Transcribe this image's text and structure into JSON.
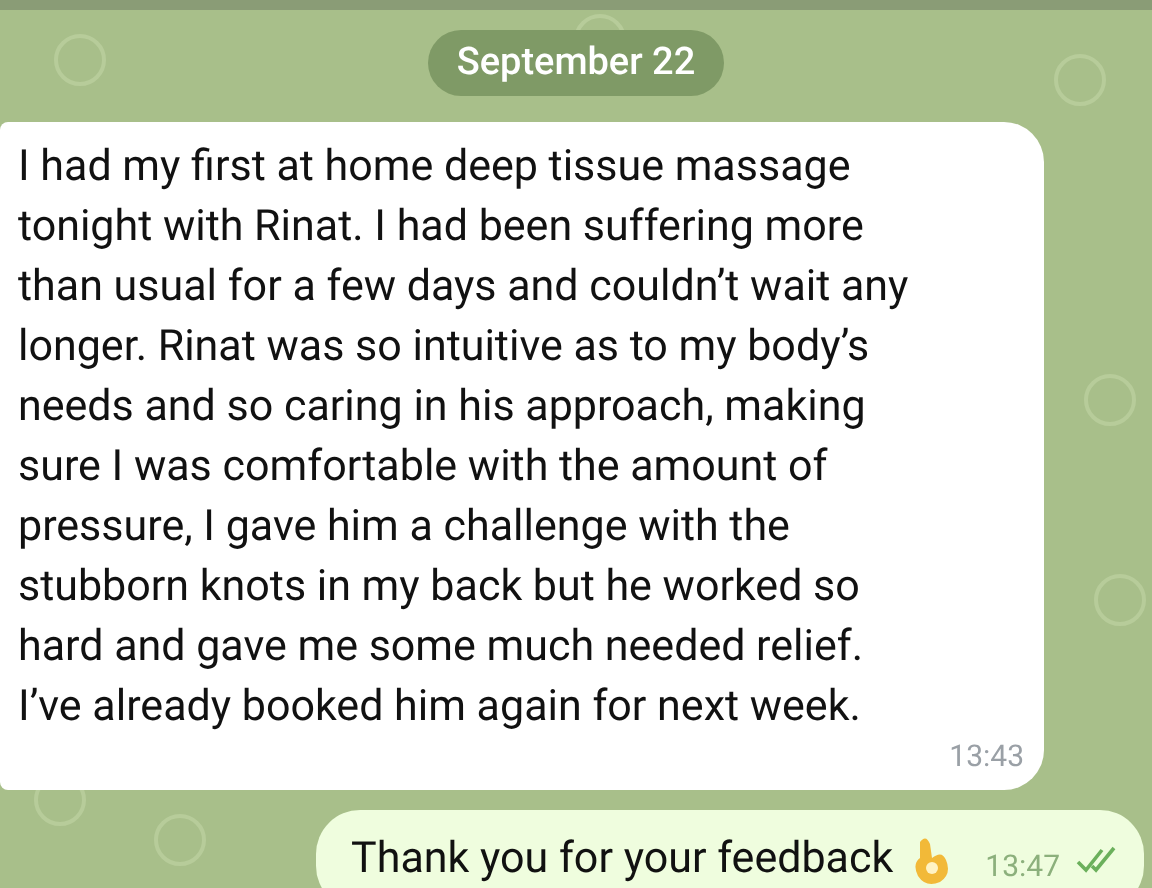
{
  "date_chip": "September 22",
  "messages": [
    {
      "kind": "incoming",
      "lines": [
        "I had my first at home deep tissue massage",
        "tonight with Rinat. I had been suffering more",
        "than usual for a few days and couldn’t wait any",
        "longer. Rinat was so intuitive as to my body’s",
        "needs and so caring in his approach, making",
        "sure I was comfortable with the amount of",
        "pressure, I gave him a challenge with the",
        "stubborn knots in my back but he worked so",
        "hard and gave me some much needed relief.",
        "I’ve already booked him again for next week."
      ],
      "time": "13:43"
    },
    {
      "kind": "outgoing",
      "lines": [
        "Thank you for your feedback"
      ],
      "time": "13:47",
      "read": true
    }
  ]
}
